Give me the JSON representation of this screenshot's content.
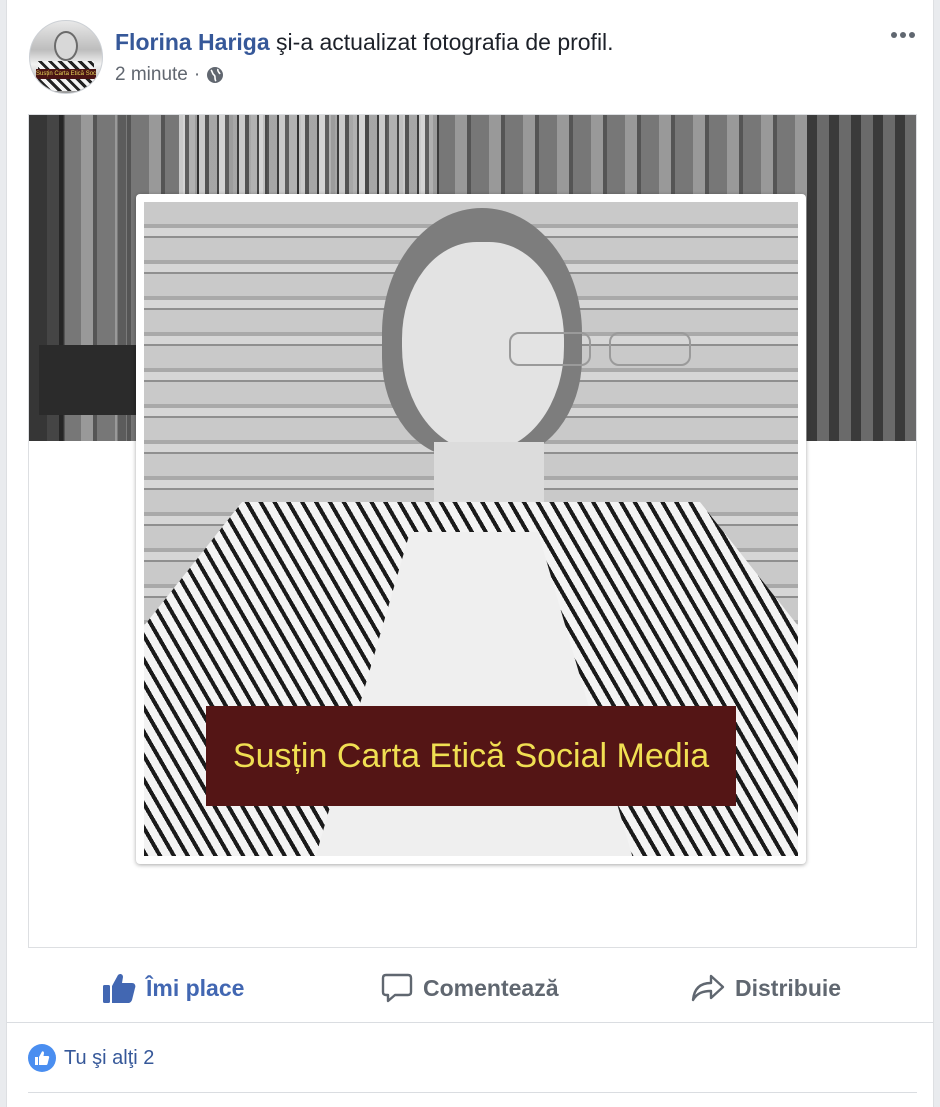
{
  "post": {
    "author": "Florina Hariga",
    "action": " şi-a actualizat fotografia de profil.",
    "time": "2 minute",
    "separator": "·",
    "privacy_icon": "globe-icon",
    "avatar_banner": "Susțin Carta Etică Social Media"
  },
  "media": {
    "banner_text": "Susțin Carta Etică Social Media"
  },
  "actions": {
    "like_label": "Îmi place",
    "comment_label": "Comentează",
    "share_label": "Distribuie"
  },
  "reactions": {
    "summary": "Tu şi alţi 2"
  },
  "colors": {
    "link": "#365899",
    "accent": "#4267b2",
    "banner_bg": "#541515",
    "banner_text": "#f0df52"
  }
}
